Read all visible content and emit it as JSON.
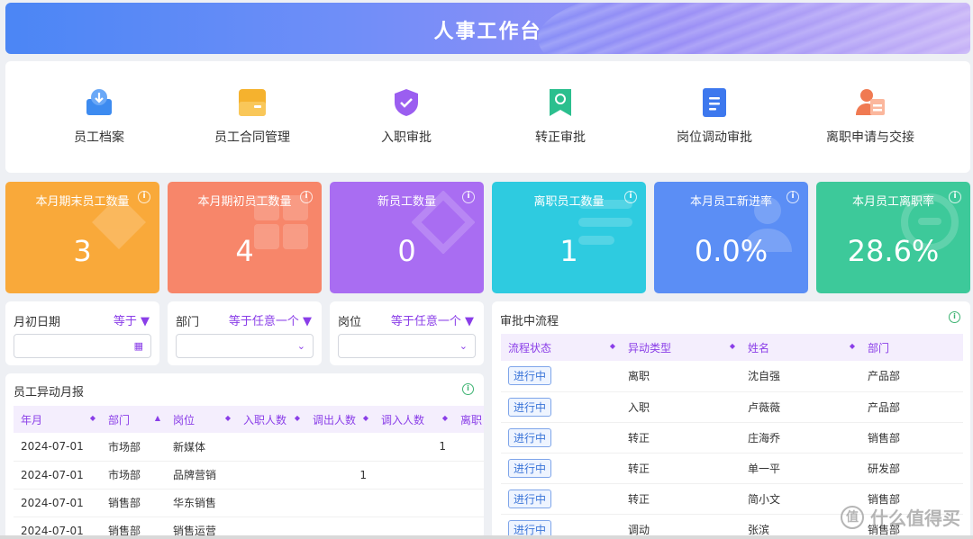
{
  "header": {
    "title": "人事工作台"
  },
  "quick_links": [
    {
      "label": "员工档案",
      "icon": "employee-file-icon",
      "color": "#3d8bf0"
    },
    {
      "label": "员工合同管理",
      "icon": "contract-icon",
      "color": "#f5b22e"
    },
    {
      "label": "入职审批",
      "icon": "shield-check-icon",
      "color": "#9b5ef0"
    },
    {
      "label": "转正审批",
      "icon": "bookmark-icon",
      "color": "#2bbf8e"
    },
    {
      "label": "岗位调动审批",
      "icon": "document-icon",
      "color": "#3d78ee"
    },
    {
      "label": "离职申请与交接",
      "icon": "person-leave-icon",
      "color": "#f07a52"
    }
  ],
  "stats": [
    {
      "title": "本月期末员工数量",
      "value": "3",
      "color": "#f9a93a"
    },
    {
      "title": "本月期初员工数量",
      "value": "4",
      "color": "#f7866a"
    },
    {
      "title": "新员工数量",
      "value": "0",
      "color": "#a96df2"
    },
    {
      "title": "离职员工数量",
      "value": "1",
      "color": "#2ecbe0"
    },
    {
      "title": "本月员工新进率",
      "value": "0.0%",
      "color": "#5b8ef5"
    },
    {
      "title": "本月员工离职率",
      "value": "28.6%",
      "color": "#3dc99a"
    }
  ],
  "filters": [
    {
      "label": "月初日期",
      "operator": "等于",
      "type": "date"
    },
    {
      "label": "部门",
      "operator": "等于任意一个",
      "type": "select"
    },
    {
      "label": "岗位",
      "operator": "等于任意一个",
      "type": "select"
    }
  ],
  "monthly_report": {
    "title": "员工异动月报",
    "columns": [
      "年月",
      "部门",
      "岗位",
      "入职人数",
      "调出人数",
      "调入人数",
      "离职"
    ],
    "rows": [
      [
        "2024-07-01",
        "市场部",
        "新媒体",
        "",
        "",
        "1",
        ""
      ],
      [
        "2024-07-01",
        "市场部",
        "品牌营销",
        "",
        "1",
        "",
        ""
      ],
      [
        "2024-07-01",
        "销售部",
        "华东销售",
        "",
        "",
        "",
        ""
      ],
      [
        "2024-07-01",
        "销售部",
        "销售运营",
        "",
        "",
        "",
        ""
      ]
    ]
  },
  "approvals": {
    "title": "审批中流程",
    "columns": [
      "流程状态",
      "异动类型",
      "姓名",
      "部门"
    ],
    "rows": [
      [
        "进行中",
        "离职",
        "沈自强",
        "产品部"
      ],
      [
        "进行中",
        "入职",
        "卢薇薇",
        "产品部"
      ],
      [
        "进行中",
        "转正",
        "庄海乔",
        "销售部"
      ],
      [
        "进行中",
        "转正",
        "单一平",
        "研发部"
      ],
      [
        "进行中",
        "转正",
        "简小文",
        "销售部"
      ],
      [
        "进行中",
        "调动",
        "张滨",
        "销售部"
      ]
    ]
  },
  "watermark": {
    "text": "什么值得买"
  },
  "accent": "#8a3ee8"
}
